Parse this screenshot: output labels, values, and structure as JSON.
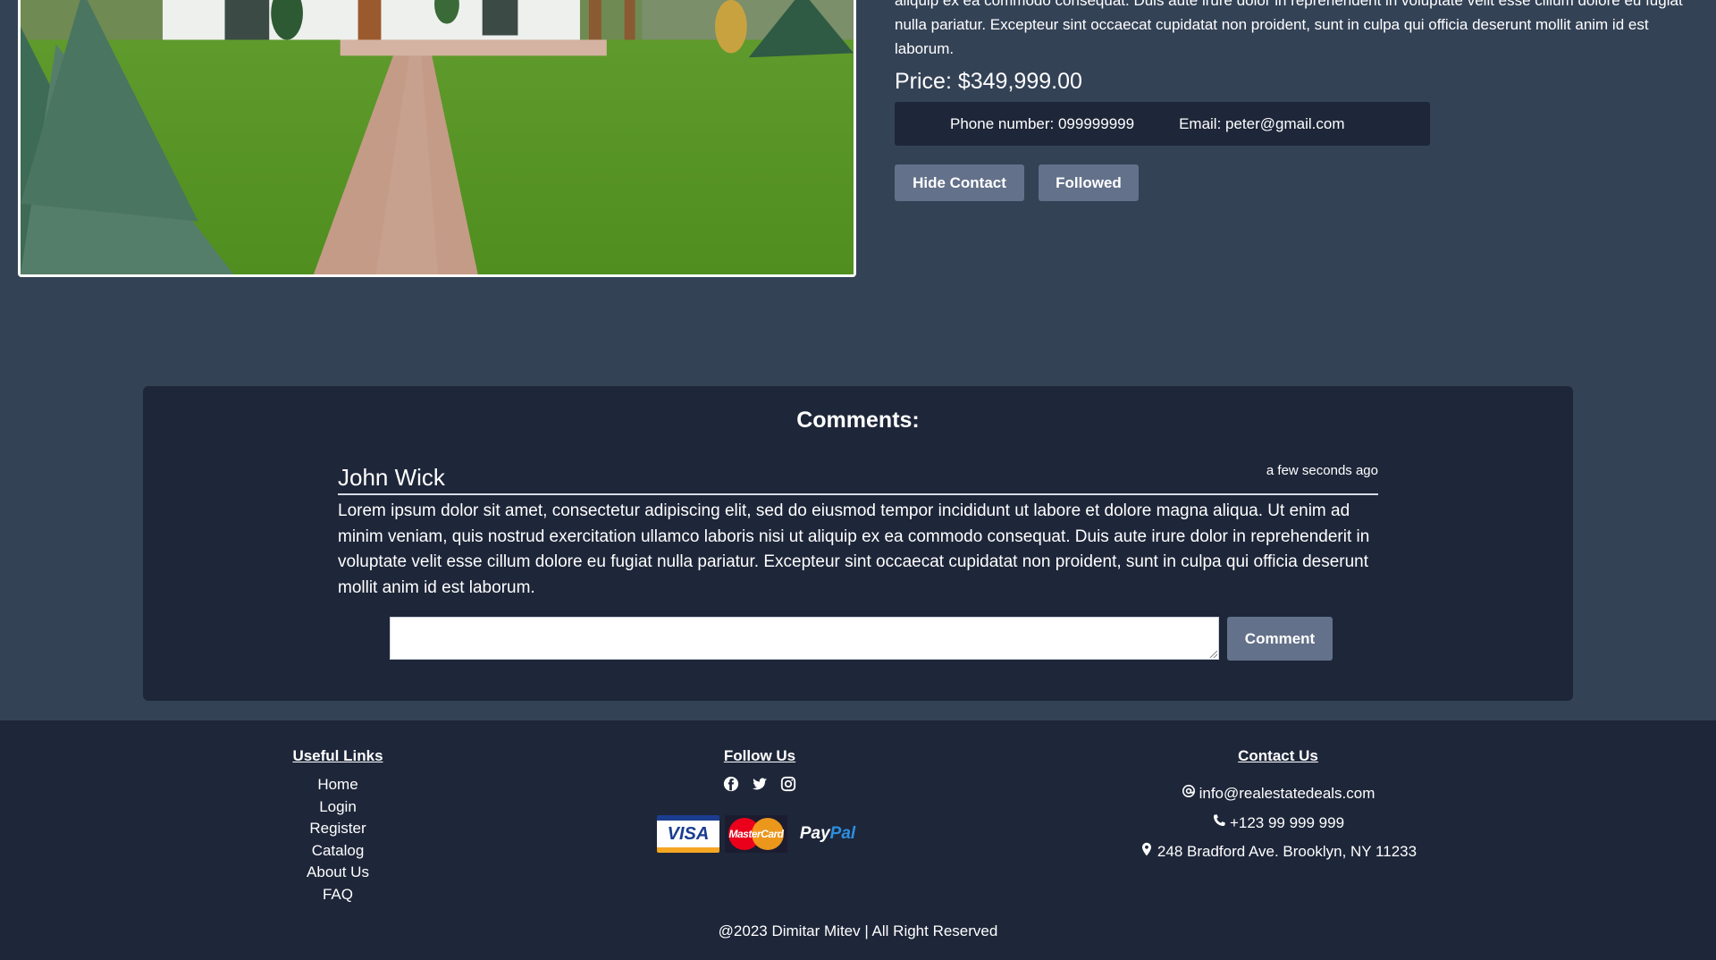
{
  "listing": {
    "description_tail": "aliquip ex ea commodo consequat. Duis aute irure dolor in reprehenderit in voluptate velit esse cillum dolore eu fugiat nulla pariatur. Excepteur sint occaecat cupidatat non proident, sunt in culpa qui officia deserunt mollit anim id est laborum.",
    "price": "Price: $349,999.00",
    "phone": "Phone number: 099999999",
    "email": "Email: peter@gmail.com",
    "hide_contact_label": "Hide Contact",
    "followed_label": "Followed"
  },
  "comments": {
    "title": "Comments:",
    "items": [
      {
        "author": "John Wick",
        "time": "a few seconds ago",
        "text": "Lorem ipsum dolor sit amet, consectetur adipiscing elit, sed do eiusmod tempor incididunt ut labore et dolore magna aliqua. Ut enim ad minim veniam, quis nostrud exercitation ullamco laboris nisi ut aliquip ex ea commodo consequat. Duis aute irure dolor in reprehenderit in voluptate velit esse cillum dolore eu fugiat nulla pariatur. Excepteur sint occaecat cupidatat non proident, sunt in culpa qui officia deserunt mollit anim id est laborum."
      }
    ],
    "input_value": "",
    "submit_label": "Comment"
  },
  "footer": {
    "useful_links": {
      "title": "Useful Links",
      "items": [
        "Home",
        "Login",
        "Register",
        "Catalog",
        "About Us",
        "FAQ"
      ]
    },
    "follow_us": {
      "title": "Follow Us",
      "icons": [
        "facebook-icon",
        "twitter-icon",
        "instagram-icon"
      ],
      "payments": {
        "visa": "VISA",
        "mastercard": "MasterCard",
        "paypal_1": "Pay",
        "paypal_2": "Pal"
      }
    },
    "contact_us": {
      "title": "Contact Us",
      "email": "info@realestatedeals.com",
      "phone": "+123 99 999 999",
      "address": "248 Bradford Ave. Brooklyn, NY 11233"
    },
    "copyright": "@2023 Dimitar Mitev | All Right Reserved"
  },
  "colors": {
    "page_bg": "#344256",
    "panel_bg": "#1e2639",
    "button_bg": "#63718a"
  }
}
